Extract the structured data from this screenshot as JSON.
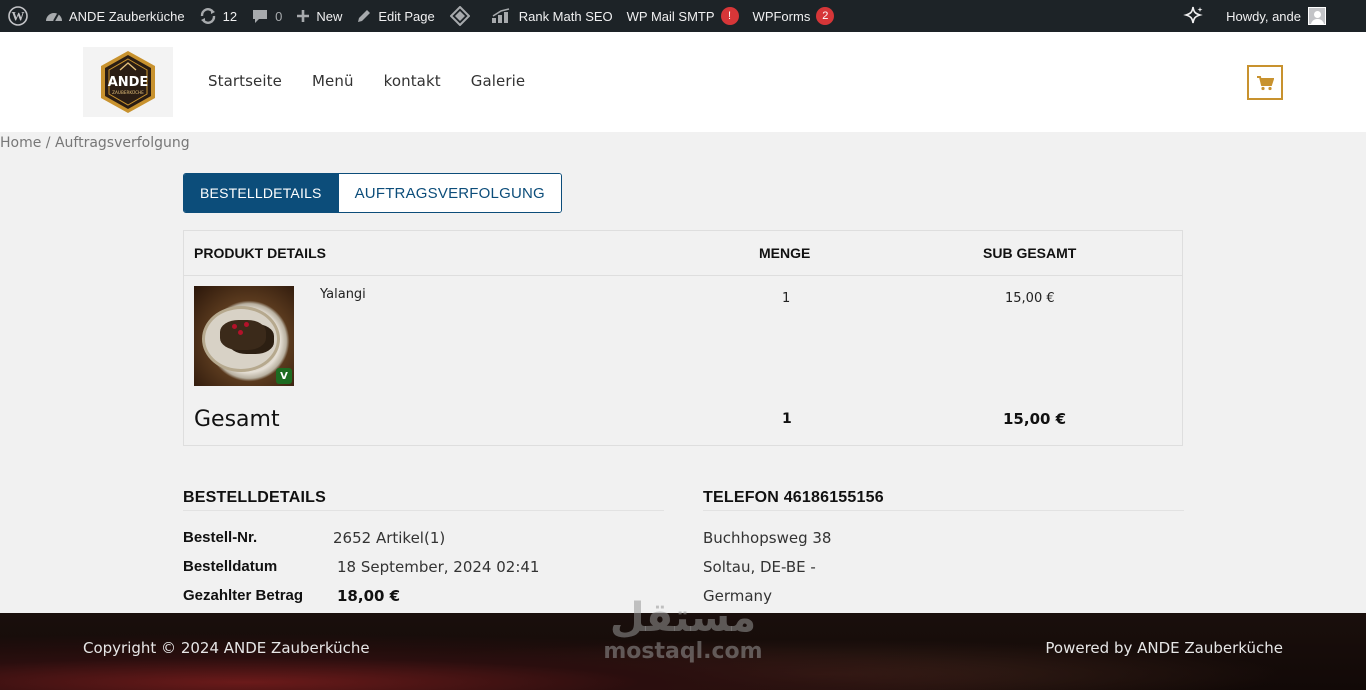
{
  "admin_bar": {
    "site_name": "ANDE Zauberküche",
    "updates_count": "12",
    "comments_count": "0",
    "new_label": "New",
    "edit_page_label": "Edit Page",
    "rank_math_label": "Rank Math SEO",
    "wp_mail_smtp_label": "WP Mail SMTP",
    "wp_mail_smtp_badge": "!",
    "wpforms_label": "WPForms",
    "wpforms_badge": "2",
    "howdy_label": "Howdy, ande"
  },
  "header": {
    "logo_text": "ANDE",
    "logo_subtext": "ZAUBERKÜCHE",
    "nav": [
      "Startseite",
      "Menü",
      "kontakt",
      "Galerie"
    ]
  },
  "breadcrumb": "Home / Auftragsverfolgung",
  "tabs": {
    "active": "BESTELLDETAILS",
    "inactive": "AUFTRAGSVERFOLGUNG"
  },
  "table": {
    "headers": {
      "product": "PRODUKT DETAILS",
      "qty": "MENGE",
      "subtotal": "SUB GESAMT"
    },
    "rows": [
      {
        "name": "Yalangi",
        "qty": "1",
        "subtotal": "15,00 €"
      }
    ],
    "total": {
      "label": "Gesamt",
      "qty": "1",
      "subtotal": "15,00 €"
    }
  },
  "order_details": {
    "title": "BESTELLDETAILS",
    "order_no_label": "Bestell-Nr.",
    "order_no_value": "2652 Artikel(1)",
    "date_label": "Bestelldatum",
    "date_value": "18 September, 2024 02:41",
    "paid_label": "Gezahlter Betrag",
    "paid_value": "18,00 €"
  },
  "contact": {
    "title": "TELEFON 46186155156",
    "address_line1": "Buchhopsweg 38",
    "address_line2": "Soltau, DE-BE -",
    "address_line3": "Germany"
  },
  "footer": {
    "copyright": "Copyright © 2024 ANDE Zauberküche",
    "powered": "Powered by ANDE Zauberküche"
  },
  "watermark": {
    "arabic": "مستقل",
    "latin": "mostaql.com"
  },
  "colors": {
    "admin_bar": "#1d2327",
    "tab_active": "#0c4d7a",
    "cart_border": "#c8922e",
    "badge": "#d63638"
  }
}
